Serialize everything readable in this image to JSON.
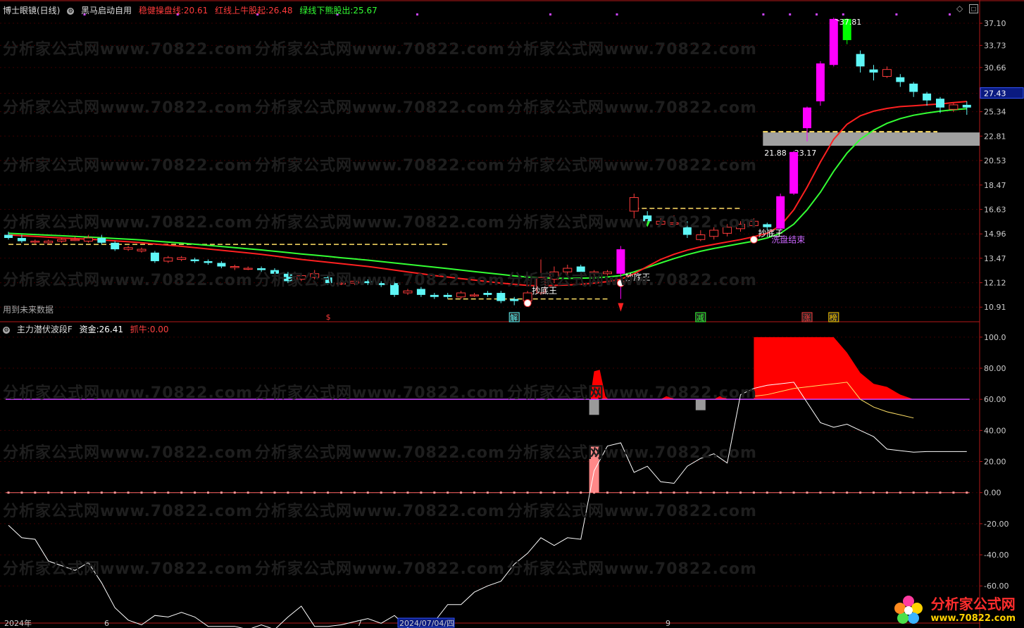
{
  "header_main": {
    "indicator_name": "博士眼镜(日线)",
    "formula_name": "黑马启动自用",
    "items": [
      {
        "label": "稳健操盘线:",
        "value": "20.61",
        "color": "#ff3b3b"
      },
      {
        "label": "红线上牛股起:",
        "value": "26.48",
        "color": "#ff3b3b"
      },
      {
        "label": "绿线下熊股出:",
        "value": "25.67",
        "color": "#33ff33"
      }
    ],
    "future_data_note": "用到未来数据"
  },
  "header_sub": {
    "formula_name": "主力潜伏波段F",
    "items": [
      {
        "label": "资金:",
        "value": "26.41",
        "color": "#ffffff"
      },
      {
        "label": "抓牛:",
        "value": "0.00",
        "color": "#ff4040"
      }
    ]
  },
  "watermark": "分析家公式网www.70822.com",
  "logo": {
    "title": "分析家公式网",
    "url": "www.70822.com"
  },
  "colors": {
    "up": "#ff3b3b",
    "down": "#5ff7f7",
    "ma_red": "#ff2020",
    "ma_green": "#33ff33",
    "strong_up": "#ff00ff",
    "strong_down": "#00ff00"
  },
  "chart_data": [
    {
      "type": "candlestick",
      "price_axis_ticks": [
        "37.10",
        "33.73",
        "30.66",
        "27.43",
        "25.34",
        "22.81",
        "20.53",
        "18.47",
        "16.63",
        "14.96",
        "13.47",
        "12.12",
        "10.91"
      ],
      "current_price_label": "27.43",
      "ylim": [
        10.4,
        38.6
      ],
      "peak_label": "37.81",
      "support_zone": {
        "low": 21.88,
        "high": 23.17,
        "label": "21.88 - 23.17"
      },
      "annotations": [
        {
          "text": "抄底王",
          "bar": 39,
          "price": 11.7,
          "color": "#ffffff"
        },
        {
          "text": "抄底王",
          "bar": 46,
          "price": 12.4,
          "color": "#ffffff"
        },
        {
          "text": "抄底王",
          "bar": 56,
          "price": 15.0,
          "color": "#ffffff"
        },
        {
          "text": "洗盘结束",
          "bar": 57,
          "price": 14.6,
          "color": "#cc66ff"
        }
      ],
      "signals": [
        {
          "text": "$",
          "bar": 24,
          "color": "#ff3b3b"
        },
        {
          "text": "解",
          "bar": 38,
          "color": "#5ff7f7"
        },
        {
          "text": "减",
          "bar": 52,
          "color": "#33ff33"
        },
        {
          "text": "涨",
          "bar": 60,
          "color": "#ff3b3b"
        },
        {
          "text": "榜",
          "bar": 62,
          "color": "#ffcc00"
        }
      ],
      "candles": [
        [
          14.9,
          14.7,
          15.1,
          14.6
        ],
        [
          14.7,
          14.5,
          14.9,
          14.4
        ],
        [
          14.5,
          14.5,
          14.6,
          14.3
        ],
        [
          14.4,
          14.5,
          14.6,
          14.3
        ],
        [
          14.5,
          14.6,
          14.7,
          14.4
        ],
        [
          14.6,
          14.6,
          14.8,
          14.5
        ],
        [
          14.5,
          14.7,
          14.9,
          14.4
        ],
        [
          14.7,
          14.4,
          14.9,
          14.3
        ],
        [
          14.4,
          14.0,
          14.5,
          13.9
        ],
        [
          14.0,
          14.1,
          14.2,
          13.9
        ],
        [
          13.9,
          14.0,
          14.1,
          13.8
        ],
        [
          13.8,
          13.3,
          13.9,
          13.2
        ],
        [
          13.3,
          13.5,
          13.6,
          13.2
        ],
        [
          13.4,
          13.5,
          13.6,
          13.3
        ],
        [
          13.4,
          13.3,
          13.5,
          13.2
        ],
        [
          13.3,
          13.2,
          13.4,
          13.1
        ],
        [
          13.2,
          13.0,
          13.3,
          12.9
        ],
        [
          13.0,
          13.0,
          13.1,
          12.8
        ],
        [
          12.9,
          12.9,
          13.0,
          12.8
        ],
        [
          12.9,
          12.8,
          13.0,
          12.7
        ],
        [
          12.8,
          12.6,
          12.9,
          12.5
        ],
        [
          12.6,
          12.2,
          12.7,
          12.1
        ],
        [
          12.3,
          12.5,
          12.6,
          12.2
        ],
        [
          12.4,
          12.6,
          12.8,
          12.3
        ],
        [
          12.4,
          12.1,
          12.5,
          12.0
        ],
        [
          12.1,
          12.1,
          12.2,
          12.0
        ],
        [
          12.1,
          12.2,
          12.3,
          12.0
        ],
        [
          12.2,
          12.1,
          12.3,
          12.0
        ],
        [
          12.1,
          12.0,
          12.2,
          11.9
        ],
        [
          12.1,
          11.5,
          12.2,
          11.4
        ],
        [
          11.6,
          11.7,
          11.8,
          11.5
        ],
        [
          11.8,
          11.5,
          11.9,
          11.4
        ],
        [
          11.5,
          11.4,
          11.6,
          11.3
        ],
        [
          11.5,
          11.4,
          11.6,
          11.3
        ],
        [
          11.4,
          11.6,
          11.7,
          11.3
        ],
        [
          11.5,
          11.5,
          11.6,
          11.4
        ],
        [
          11.6,
          11.5,
          11.7,
          11.4
        ],
        [
          11.6,
          11.2,
          11.7,
          11.1
        ],
        [
          11.3,
          11.2,
          11.4,
          11.0
        ],
        [
          11.2,
          11.6,
          11.7,
          11.0
        ],
        [
          11.6,
          12.4,
          13.4,
          11.5
        ],
        [
          12.3,
          12.7,
          13.0,
          12.1
        ],
        [
          12.7,
          12.9,
          13.1,
          12.5
        ],
        [
          13.0,
          12.7,
          13.1,
          12.5
        ],
        [
          12.6,
          12.7,
          12.8,
          12.4
        ],
        [
          12.6,
          12.7,
          12.8,
          12.5
        ],
        [
          12.6,
          14.0,
          14.2,
          11.3
        ],
        [
          16.5,
          17.5,
          17.8,
          16.0
        ],
        [
          16.2,
          15.8,
          16.5,
          15.7
        ],
        [
          15.6,
          15.8,
          16.0,
          15.5
        ],
        [
          15.6,
          15.7,
          16.2,
          15.4
        ],
        [
          15.4,
          14.9,
          15.8,
          14.7
        ],
        [
          14.6,
          14.9,
          15.2,
          14.5
        ],
        [
          14.8,
          15.2,
          15.4,
          14.6
        ],
        [
          15.0,
          15.4,
          15.6,
          14.8
        ],
        [
          15.3,
          15.6,
          15.8,
          15.1
        ],
        [
          15.5,
          15.8,
          16.0,
          15.4
        ],
        [
          15.6,
          15.4,
          15.7,
          15.2
        ],
        [
          15.3,
          17.6,
          17.8,
          15.1
        ],
        [
          17.8,
          21.3,
          21.4,
          17.7
        ],
        [
          23.6,
          25.8,
          25.9,
          22.3
        ],
        [
          26.5,
          31.2,
          31.5,
          26.0
        ],
        [
          31.0,
          37.8,
          38.0,
          30.8
        ],
        [
          37.8,
          34.5,
          37.9,
          33.9
        ],
        [
          32.5,
          30.8,
          33.0,
          30.0
        ],
        [
          30.4,
          30.0,
          31.0,
          29.0
        ],
        [
          29.5,
          30.4,
          30.8,
          29.3
        ],
        [
          29.4,
          28.8,
          29.8,
          28.2
        ],
        [
          28.6,
          27.6,
          28.8,
          27.0
        ],
        [
          27.4,
          26.6,
          27.6,
          26.0
        ],
        [
          26.8,
          25.8,
          27.0,
          25.2
        ],
        [
          25.6,
          26.1,
          26.3,
          25.3
        ],
        [
          26.1,
          25.8,
          26.5,
          25.0
        ]
      ],
      "ma_red": [
        14.9,
        14.85,
        14.8,
        14.75,
        14.7,
        14.66,
        14.62,
        14.58,
        14.52,
        14.46,
        14.4,
        14.32,
        14.25,
        14.18,
        14.1,
        14.02,
        13.94,
        13.86,
        13.78,
        13.7,
        13.6,
        13.5,
        13.4,
        13.32,
        13.24,
        13.16,
        13.08,
        13.0,
        12.9,
        12.8,
        12.7,
        12.6,
        12.5,
        12.42,
        12.34,
        12.26,
        12.18,
        12.1,
        12.04,
        11.98,
        11.96,
        11.98,
        12.0,
        12.04,
        12.1,
        12.18,
        12.3,
        12.6,
        13.0,
        13.4,
        13.7,
        13.95,
        14.15,
        14.3,
        14.45,
        14.6,
        14.78,
        15.0,
        15.5,
        16.6,
        18.3,
        20.4,
        22.5,
        24.0,
        24.9,
        25.4,
        25.7,
        25.9,
        26.0,
        26.1,
        26.2,
        26.35,
        26.48
      ],
      "ma_green": [
        15.0,
        14.96,
        14.92,
        14.88,
        14.84,
        14.8,
        14.76,
        14.72,
        14.67,
        14.62,
        14.57,
        14.5,
        14.44,
        14.38,
        14.31,
        14.24,
        14.17,
        14.1,
        14.03,
        13.96,
        13.88,
        13.8,
        13.72,
        13.65,
        13.58,
        13.5,
        13.43,
        13.36,
        13.28,
        13.2,
        13.12,
        13.04,
        12.96,
        12.88,
        12.8,
        12.72,
        12.64,
        12.56,
        12.48,
        12.42,
        12.38,
        12.36,
        12.35,
        12.36,
        12.38,
        12.42,
        12.5,
        12.7,
        12.95,
        13.2,
        13.45,
        13.68,
        13.88,
        14.05,
        14.2,
        14.35,
        14.5,
        14.7,
        15.0,
        15.6,
        16.6,
        17.9,
        19.6,
        21.2,
        22.5,
        23.4,
        24.1,
        24.6,
        24.95,
        25.2,
        25.4,
        25.55,
        25.67
      ]
    },
    {
      "type": "line",
      "y_axis_ticks": [
        "100.0",
        "80.00",
        "60.00",
        "40.00",
        "20.00",
        "0.00",
        "-20.00",
        "-40.00",
        "-60.00"
      ],
      "ylim": [
        -78,
        104
      ],
      "x_tick_labels": [
        "2024年",
        "6",
        "7",
        "2024/07/04/四",
        "9"
      ],
      "threshold_line": 60,
      "zero_line": 0,
      "series": [
        {
          "values": [
            -21,
            -29,
            -30,
            -44,
            -47,
            -50,
            -45,
            -58,
            -74,
            -82,
            -85,
            -79,
            -80,
            -77,
            -80,
            -86,
            -86,
            -86,
            -88,
            -85,
            -88,
            -80,
            -73,
            -86,
            -86,
            -85,
            -83,
            -81,
            -84,
            -79,
            -87,
            -81,
            -83,
            -72,
            -72,
            -64,
            -60,
            -57,
            -46,
            -39,
            -29,
            -34,
            -29,
            -30,
            14,
            30,
            32,
            13,
            17,
            7,
            6,
            17,
            22,
            25,
            19,
            63,
            67,
            69,
            70,
            71,
            58,
            45,
            42,
            44,
            40,
            36,
            28,
            27,
            26,
            26.41,
            26.41,
            26.41,
            26.41
          ],
          "color": "#ffffff"
        }
      ],
      "red_area": {
        "start": 56,
        "values": [
          100,
          100,
          100,
          100,
          100,
          100,
          100,
          90,
          77,
          70,
          68,
          63,
          60
        ]
      },
      "small_red_humps": [
        {
          "bar": 44,
          "values": [
            78,
            79,
            62
          ]
        },
        {
          "bar": 49,
          "values": [
            60,
            62,
            61
          ]
        },
        {
          "bar": 53,
          "values": [
            60,
            62,
            61
          ]
        }
      ],
      "gray_bars": [
        {
          "bar": 44,
          "value": 50
        },
        {
          "bar": 52,
          "value": 53
        }
      ],
      "pink_bars": [
        {
          "bar": 44,
          "value": 30
        }
      ]
    }
  ]
}
